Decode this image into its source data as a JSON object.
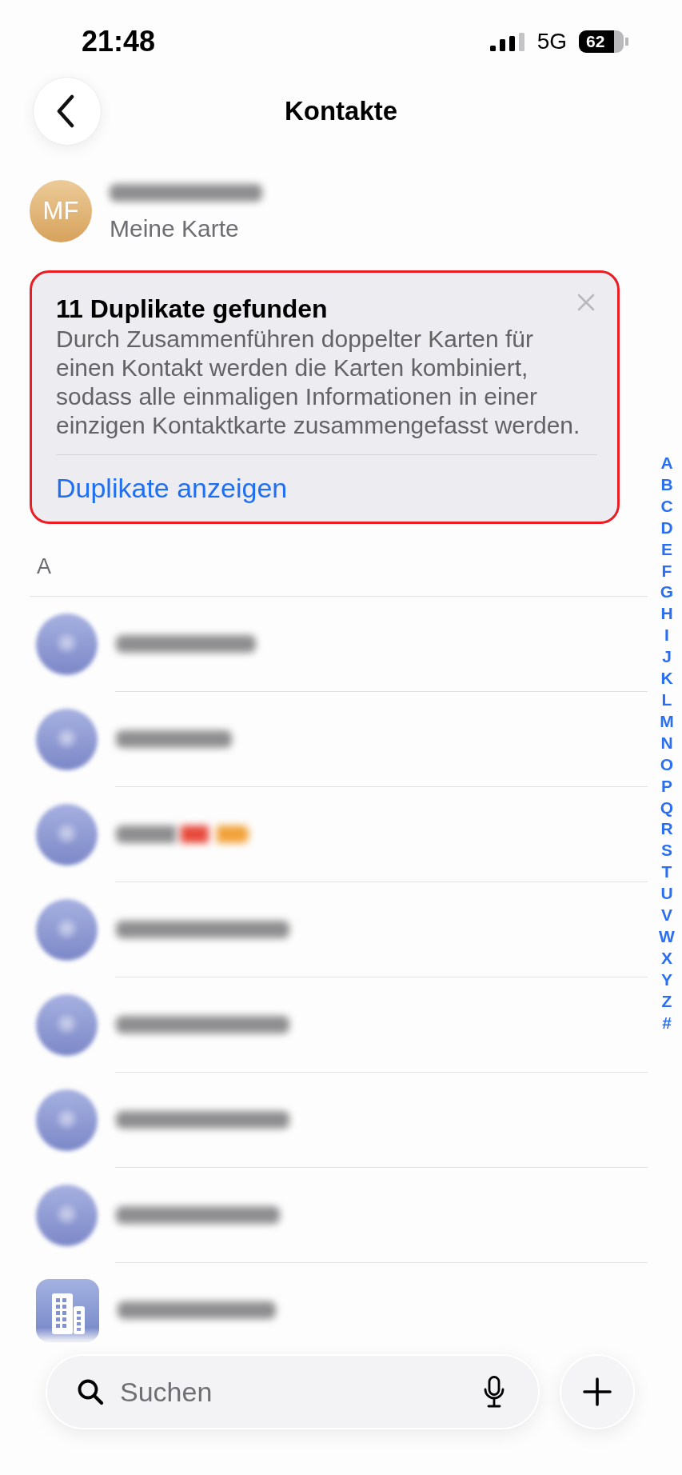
{
  "status_bar": {
    "time": "21:48",
    "network": "5G",
    "battery": "62"
  },
  "navigation": {
    "title": "Kontakte"
  },
  "my_card": {
    "initials": "MF",
    "subtitle": "Meine Karte"
  },
  "duplicates_card": {
    "highlighted": true,
    "title": "11 Duplikate gefunden",
    "text": "Durch Zusammenführen doppelter Karten für einen Kontakt werden die Karten kombiniert, sodass alle einmaligen Informationen in einer einzigen Kontaktkarte zusammengefasst werden.",
    "link": "Duplikate anzeigen"
  },
  "contacts": {
    "sections": [
      {
        "header": "A",
        "items": [
          {
            "kind": "person"
          },
          {
            "kind": "person"
          },
          {
            "kind": "person"
          },
          {
            "kind": "person"
          },
          {
            "kind": "person"
          },
          {
            "kind": "person"
          },
          {
            "kind": "person"
          },
          {
            "kind": "company"
          }
        ]
      }
    ]
  },
  "section_index": [
    "A",
    "B",
    "C",
    "D",
    "E",
    "F",
    "G",
    "H",
    "I",
    "J",
    "K",
    "L",
    "M",
    "N",
    "O",
    "P",
    "Q",
    "R",
    "S",
    "T",
    "U",
    "V",
    "W",
    "X",
    "Y",
    "Z",
    "#"
  ],
  "search": {
    "placeholder": "Suchen"
  }
}
